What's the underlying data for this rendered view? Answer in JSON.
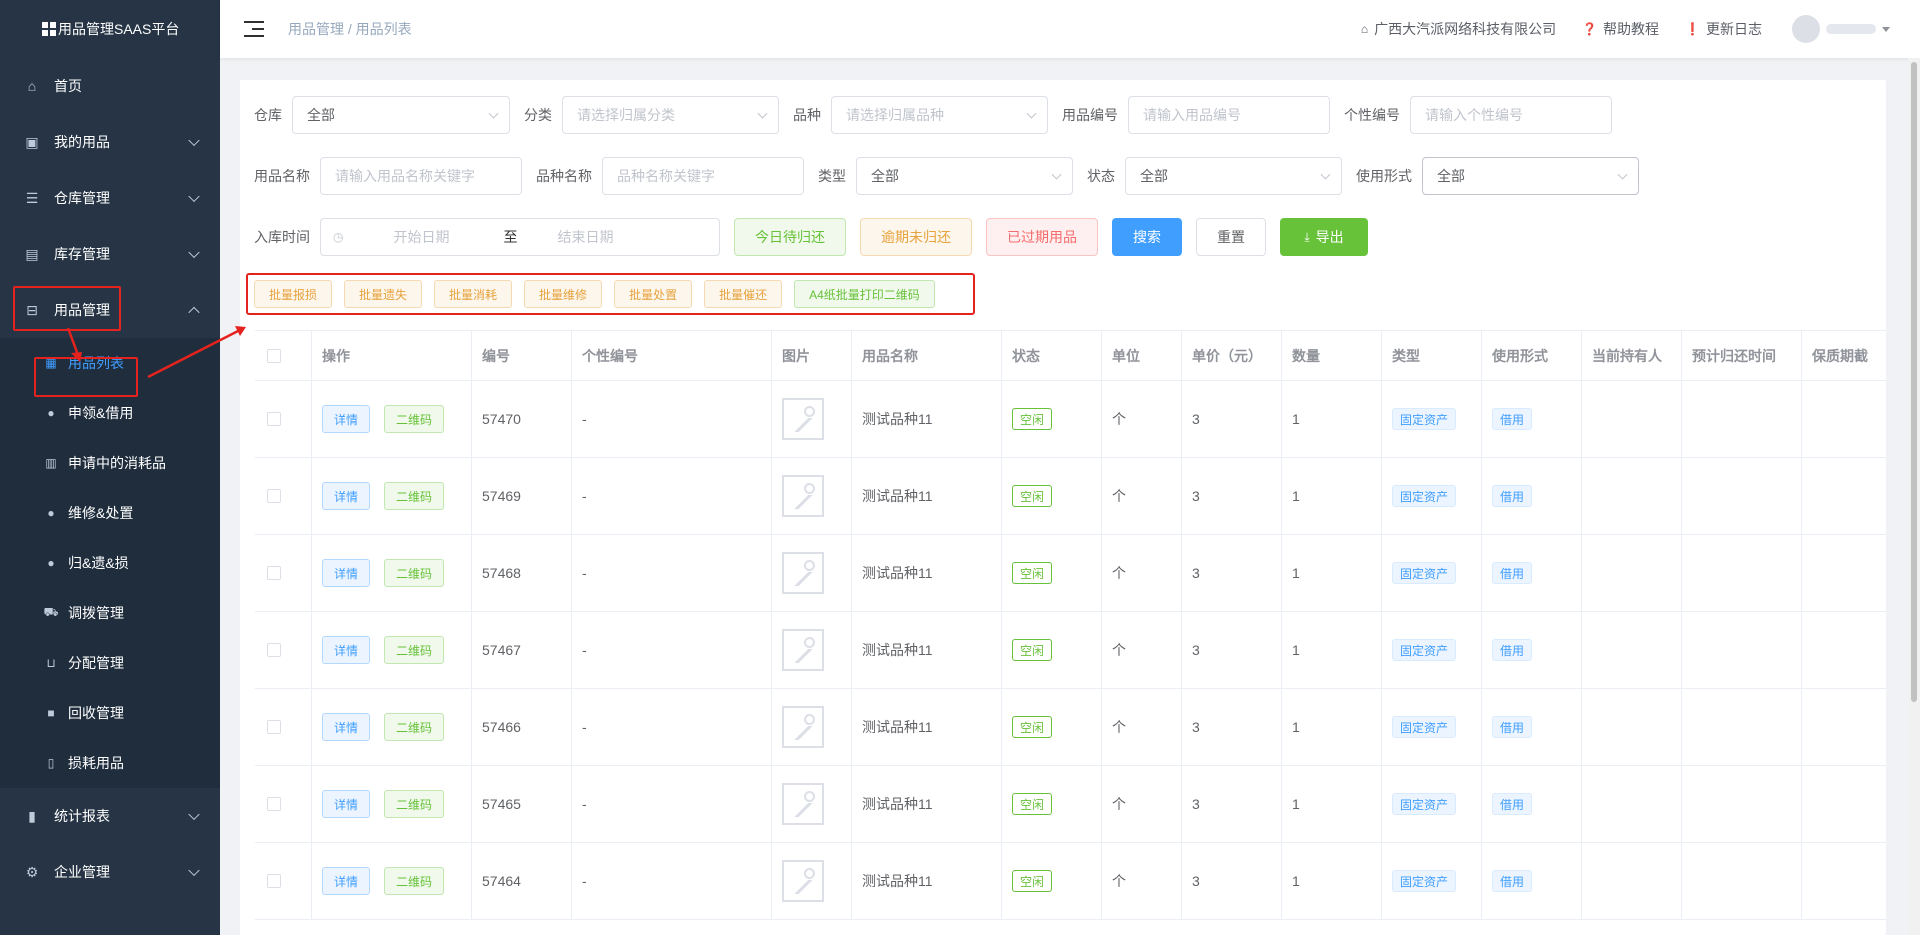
{
  "app": {
    "title": "用品管理SAAS平台"
  },
  "sidebar": {
    "items": [
      {
        "label": "首页",
        "icon": "home-icon"
      },
      {
        "label": "我的用品",
        "icon": "bag-icon"
      },
      {
        "label": "仓库管理",
        "icon": "database-icon"
      },
      {
        "label": "库存管理",
        "icon": "suitcase-icon"
      },
      {
        "label": "用品管理",
        "icon": "inbox-icon"
      }
    ],
    "sub_items": [
      {
        "label": "用品列表",
        "icon": "document-icon"
      },
      {
        "label": "申领&借用",
        "icon": "user-icon"
      },
      {
        "label": "申请中的消耗品",
        "icon": "clipboard-icon"
      },
      {
        "label": "维修&处置",
        "icon": "user-icon"
      },
      {
        "label": "归&遗&损",
        "icon": "user-icon"
      },
      {
        "label": "调拨管理",
        "icon": "truck-icon"
      },
      {
        "label": "分配管理",
        "icon": "cart-icon"
      },
      {
        "label": "回收管理",
        "icon": "box-icon"
      },
      {
        "label": "损耗用品",
        "icon": "trash-icon"
      }
    ],
    "bottom_items": [
      {
        "label": "统计报表",
        "icon": "bar-chart-icon"
      },
      {
        "label": "企业管理",
        "icon": "gear-icon"
      }
    ]
  },
  "header": {
    "breadcrumb_root": "用品管理",
    "breadcrumb_sep": "/",
    "breadcrumb_current": "用品列表",
    "company": "广西大汽派网络科技有限公司",
    "help": "帮助教程",
    "changelog": "更新日志"
  },
  "filters": {
    "warehouse_label": "仓库",
    "warehouse_value": "全部",
    "category_label": "分类",
    "category_placeholder": "请选择归属分类",
    "variety_label": "品种",
    "variety_placeholder": "请选择归属品种",
    "code_label": "用品编号",
    "code_placeholder": "请输入用品编号",
    "custom_code_label": "个性编号",
    "custom_code_placeholder": "请输入个性编号",
    "name_label": "用品名称",
    "name_placeholder": "请输入用品名称关键字",
    "variety_name_label": "品种名称",
    "variety_name_placeholder": "品种名称关键字",
    "type_label": "类型",
    "type_value": "全部",
    "status_label": "状态",
    "status_value": "全部",
    "usage_label": "使用形式",
    "usage_value": "全部",
    "date_label": "入库时间",
    "date_start": "开始日期",
    "date_sep": "至",
    "date_end": "结束日期"
  },
  "actions": {
    "due_today": "今日待归还",
    "overdue": "逾期未归还",
    "expired": "已过期用品",
    "search": "搜索",
    "reset": "重置",
    "export": "导出"
  },
  "batch": [
    "批量报损",
    "批量遗失",
    "批量消耗",
    "批量维修",
    "批量处置",
    "批量催还",
    "A4纸批量打印二维码"
  ],
  "table": {
    "columns": [
      "操作",
      "编号",
      "个性编号",
      "图片",
      "用品名称",
      "状态",
      "单位",
      "单价（元）",
      "数量",
      "类型",
      "使用形式",
      "当前持有人",
      "预计归还时间",
      "保质期截"
    ],
    "detail_label": "详情",
    "qrcode_label": "二维码",
    "rows": [
      {
        "id": "57470",
        "custom": "-",
        "name": "测试品种11",
        "status": "空闲",
        "unit": "个",
        "price": "3",
        "qty": "1",
        "type": "固定资产",
        "usage": "借用"
      },
      {
        "id": "57469",
        "custom": "-",
        "name": "测试品种11",
        "status": "空闲",
        "unit": "个",
        "price": "3",
        "qty": "1",
        "type": "固定资产",
        "usage": "借用"
      },
      {
        "id": "57468",
        "custom": "-",
        "name": "测试品种11",
        "status": "空闲",
        "unit": "个",
        "price": "3",
        "qty": "1",
        "type": "固定资产",
        "usage": "借用"
      },
      {
        "id": "57467",
        "custom": "-",
        "name": "测试品种11",
        "status": "空闲",
        "unit": "个",
        "price": "3",
        "qty": "1",
        "type": "固定资产",
        "usage": "借用"
      },
      {
        "id": "57466",
        "custom": "-",
        "name": "测试品种11",
        "status": "空闲",
        "unit": "个",
        "price": "3",
        "qty": "1",
        "type": "固定资产",
        "usage": "借用"
      },
      {
        "id": "57465",
        "custom": "-",
        "name": "测试品种11",
        "status": "空闲",
        "unit": "个",
        "price": "3",
        "qty": "1",
        "type": "固定资产",
        "usage": "借用"
      },
      {
        "id": "57464",
        "custom": "-",
        "name": "测试品种11",
        "status": "空闲",
        "unit": "个",
        "price": "3",
        "qty": "1",
        "type": "固定资产",
        "usage": "借用"
      }
    ]
  },
  "colors": {
    "sidebar_bg": "#263445",
    "primary": "#409eff",
    "success": "#67c23a",
    "warning": "#e6a23c",
    "danger": "#f56c6c",
    "annotation_red": "#e5231e"
  }
}
